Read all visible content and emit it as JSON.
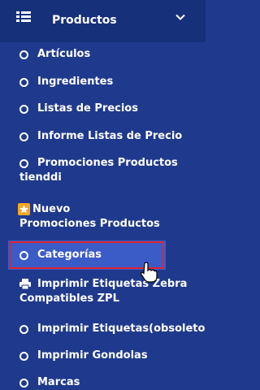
{
  "header": {
    "title": "Productos",
    "menu_icon": "list-icon",
    "chevron": "chevron-down-icon"
  },
  "items": [
    {
      "label": "Artículos",
      "icon": "circle-icon"
    },
    {
      "label": "Ingredientes",
      "icon": "circle-icon"
    },
    {
      "label": "Listas de Precios",
      "icon": "circle-icon"
    },
    {
      "label": "Informe Listas de Precio",
      "icon": "circle-icon"
    },
    {
      "label": "Promociones Productos",
      "label2": "tienddi",
      "icon": "circle-icon"
    },
    {
      "label": "Nuevo",
      "label2": "Promociones Productos",
      "icon": "star-icon"
    },
    {
      "label": "Categorías",
      "icon": "circle-icon",
      "active": true
    },
    {
      "label": "Imprimir Etiquetas Zebra",
      "label2": "Compatibles ZPL",
      "icon": "printer-icon"
    },
    {
      "label": "Imprimir Etiquetas(obsoleto",
      "icon": "circle-icon"
    },
    {
      "label": "Imprimir Gondolas",
      "icon": "circle-icon"
    },
    {
      "label": "Marcas",
      "icon": "circle-icon"
    }
  ],
  "colors": {
    "sidebar_bg": "#1f3a8c",
    "header_bg": "#17307a",
    "active_bg": "#3b5bc7",
    "highlight_border": "#e0232e",
    "star": "#f5a623"
  }
}
